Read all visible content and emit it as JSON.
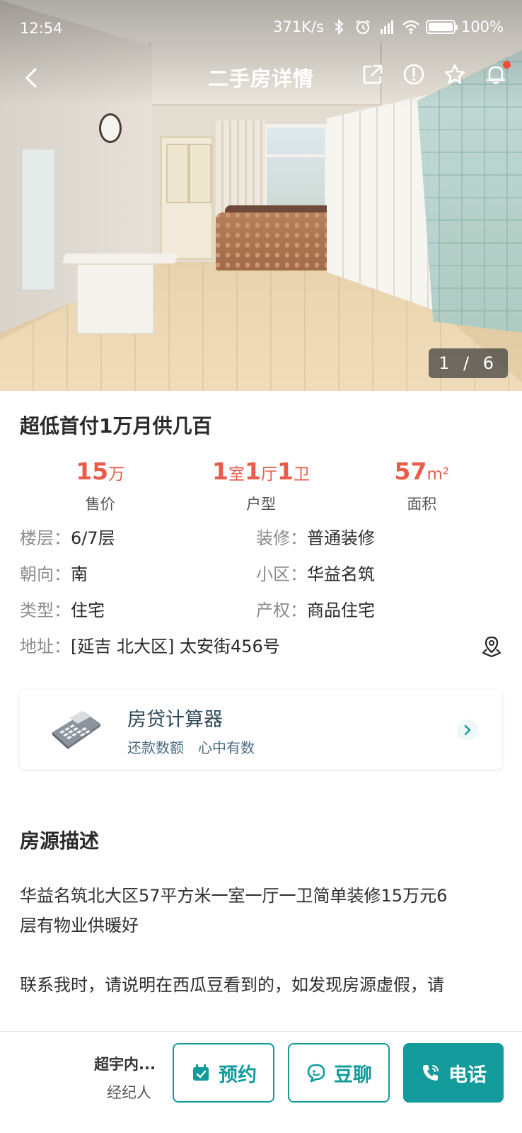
{
  "status_bar": {
    "time": "12:54",
    "net_speed": "371K/s",
    "battery": "100%"
  },
  "nav": {
    "title": "二手房详情"
  },
  "gallery": {
    "counter": "1 / 6"
  },
  "listing": {
    "title": "超低首付1万月供几百",
    "stats": {
      "price": {
        "value": "15",
        "unit": "万",
        "label": "售价"
      },
      "layout": {
        "n1": "1",
        "u1": "室",
        "n2": "1",
        "u2": "厅",
        "n3": "1",
        "u3": "卫",
        "label": "户型"
      },
      "area": {
        "value": "57",
        "unit": "m²",
        "label": "面积"
      }
    },
    "info": {
      "floor_label": "楼层：",
      "floor": "6/7层",
      "decor_label": "装修：",
      "decor": "普通装修",
      "orientation_label": "朝向：",
      "orientation": "南",
      "community_label": "小区：",
      "community": "华益名筑",
      "type_label": "类型：",
      "type": "住宅",
      "property_label": "产权：",
      "property": "商品住宅",
      "address_label": "地址：",
      "address": "[延吉 北大区] 太安街456号"
    }
  },
  "calculator": {
    "title": "房贷计算器",
    "subtitle": "还款数额　心中有数"
  },
  "description": {
    "title": "房源描述",
    "para1_line1": "华益名筑北大区57平方米一室一厅一卫简单装修15万元6",
    "para1_line2": "层有物业供暖好",
    "para2_line1": "联系我时，请说明在西瓜豆看到的，如发现房源虚假，请"
  },
  "bottom_bar": {
    "agent_name": "超宇内...",
    "agent_role": "经纪人",
    "appointment": "预约",
    "chat": "豆聊",
    "call": "电话"
  },
  "colors": {
    "accent": "#139a9b",
    "price_red": "#e85d4a",
    "notify_dot": "#f04a3a"
  },
  "icons": [
    "back-icon",
    "share-icon",
    "report-icon",
    "star-icon",
    "bell-icon",
    "location-icon",
    "calculator-icon",
    "chevron-right-icon",
    "calendar-icon",
    "chat-icon",
    "phone-icon"
  ]
}
